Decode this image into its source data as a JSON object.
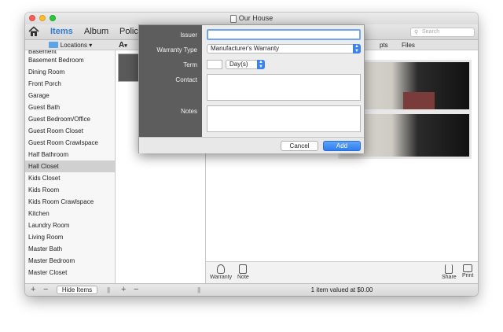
{
  "window": {
    "title": "Our House"
  },
  "toolbar": {
    "nav": [
      "Items",
      "Album",
      "Polici"
    ],
    "search_placeholder": "Search"
  },
  "locations": {
    "header": "Locations",
    "items": [
      "Basement",
      "Basement Bedroom",
      "Dining Room",
      "Front Porch",
      "Garage",
      "Guest Bath",
      "Guest Bedroom/Office",
      "Guest Room Closet",
      "Guest Room Crawlspace",
      "Half Bathroom",
      "Hall Closet",
      "Kids Closet",
      "Kids Room",
      "Kids Room Crawlspace",
      "Kitchen",
      "Laundry Room",
      "Living Room",
      "Master Bath",
      "Master Bedroom",
      "Master Closet"
    ],
    "selected": "Hall Closet"
  },
  "items_column": {
    "sort_label": "A"
  },
  "detail": {
    "tabs": [
      "pts",
      "Files"
    ],
    "bottom_left": [
      {
        "label": "Warranty",
        "icon": "warranty-icon"
      },
      {
        "label": "Note",
        "icon": "note-icon"
      }
    ],
    "bottom_right": [
      {
        "label": "Share",
        "icon": "share-icon"
      },
      {
        "label": "Print",
        "icon": "print-icon"
      }
    ]
  },
  "statusbar": {
    "hide_items": "Hide Items",
    "summary": "1 item valued at $0.00"
  },
  "dialog": {
    "labels": {
      "issuer": "Issuer",
      "warranty_type": "Warranty Type",
      "term": "Term",
      "contact": "Contact",
      "notes": "Notes"
    },
    "warranty_type_value": "Manufacturer's Warranty",
    "term_unit": "Day(s)",
    "cancel": "Cancel",
    "add": "Add"
  },
  "colors": {
    "accent": "#2f7ad8",
    "button_primary": "#3d82f2",
    "sheet_sidebar": "#5d5d5d"
  }
}
